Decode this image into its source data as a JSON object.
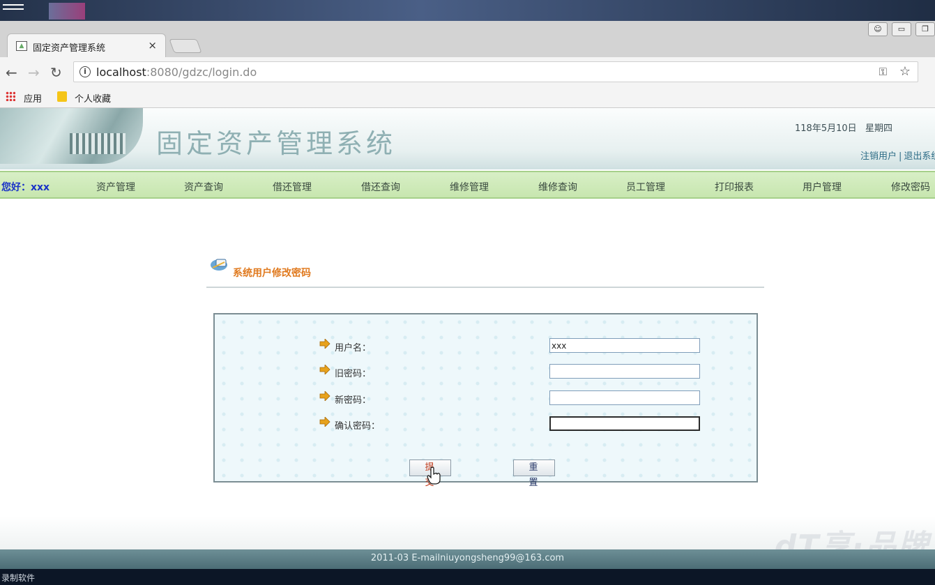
{
  "browser": {
    "tab_title": "固定资产管理系统",
    "tab_close": "×",
    "url_host": "localhost",
    "url_rest": ":8080/gdzc/login.do",
    "info_glyph": "i",
    "bookmarks": [
      "应用",
      "个人收藏"
    ]
  },
  "header": {
    "system_title": "固定资产管理系统",
    "date": "118年5月10日",
    "weekday": "星期四",
    "logout_user": "注销用户",
    "separator": "|",
    "exit_system": "退出系统"
  },
  "nav": {
    "greeting": "您好：xxx",
    "items": [
      "资产管理",
      "资产查询",
      "借还管理",
      "借还查询",
      "维修管理",
      "维修查询",
      "员工管理",
      "打印报表",
      "用户管理",
      "修改密码"
    ]
  },
  "form": {
    "section_title": "系统用户修改密码",
    "fields": [
      {
        "label": "用户名：",
        "value": "xxx"
      },
      {
        "label": "旧密码：",
        "value": ""
      },
      {
        "label": "新密码：",
        "value": ""
      },
      {
        "label": "确认密码：",
        "value": ""
      }
    ],
    "submit_label": "提交",
    "reset_label": "重置"
  },
  "footer": {
    "text": "2011-03 E-mailniuyongsheng99@163.com",
    "watermark": "dT享·品牌"
  },
  "os": {
    "bottom_label": "录制软件"
  },
  "colors": {
    "nav_bg": "#c7e6af",
    "greeting": "#1a33c7",
    "section_title": "#e07a1f",
    "footer_bg": "#4c6d76"
  }
}
